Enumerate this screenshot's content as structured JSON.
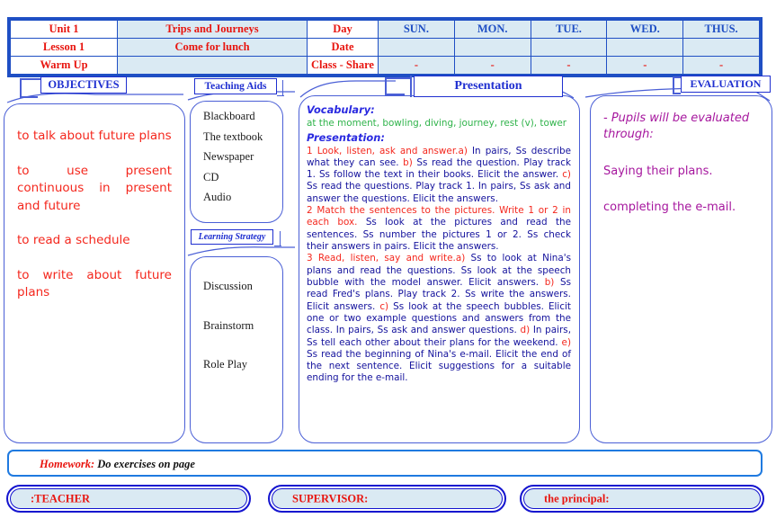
{
  "header_table": {
    "rows": [
      {
        "label": "Unit 1",
        "value": "Trips and Journeys",
        "key": "Day",
        "days": [
          "SUN.",
          "MON.",
          "TUE.",
          "WED.",
          "THUS."
        ]
      },
      {
        "label": "Lesson 1",
        "value": "Come for lunch",
        "key": "Date",
        "days": [
          "",
          "",
          "",
          "",
          ""
        ]
      },
      {
        "label": "Warm Up",
        "value": "",
        "key": "Class - Share",
        "days": [
          "-",
          "-",
          "-",
          "-",
          "-"
        ]
      }
    ]
  },
  "objectives": {
    "tag": "OBJECTIVES",
    "items": [
      "to talk about future plans",
      "to use present continuous in present and future",
      "to read a schedule",
      "to write about future plans"
    ]
  },
  "teaching_aids": {
    "tag": "Teaching Aids",
    "items": [
      "Blackboard",
      "The textbook",
      "Newspaper",
      "CD",
      "Audio"
    ]
  },
  "learning_strategy": {
    "tag": "Learning Strategy",
    "items": [
      "Discussion",
      "Brainstorm",
      "Role Play"
    ]
  },
  "presentation": {
    "tag": "Presentation",
    "vocabulary_heading": "Vocabulary:",
    "vocabulary": "at the moment, bowling, diving, journey, rest (v), tower",
    "presentation_heading": "Presentation:",
    "item1_title": "1 Look, listen, ask and answer.",
    "item1_a": "a)",
    "item1_a_text": " In pairs, Ss describe what they can see. ",
    "item1_b": "b)",
    "item1_b_text": " Ss read the question. Play track 1. Ss follow the text in their books. Elicit the answer. ",
    "item1_c": "c)",
    "item1_c_text": " Ss read the questions. Play track 1. In pairs, Ss ask and answer the questions. Elicit the answers.",
    "item2_title": "2 Match the sentences to the pictures. Write 1 or 2 in each box.",
    "item2_text": " Ss look at the pictures and read the sentences. Ss number the pictures 1 or 2. Ss check their answers in pairs. Elicit the answers.",
    "item3_title": "3 Read, listen, say and write.",
    "item3_a": "a)",
    "item3_a_text": " Ss to look at Nina's plans and read the questions. Ss look at the speech bubble with the model answer. Elicit answers. ",
    "item3_b": "b)",
    "item3_b_text": " Ss read Fred's plans. Play track 2. Ss write the answers. Elicit answers. ",
    "item3_c": "c)",
    "item3_c_text": " Ss look at the speech bubbles. Elicit one or two example questions and answers from the class. In pairs, Ss ask and answer questions. ",
    "item3_d": "d)",
    "item3_d_text": " In pairs, Ss tell each other about their plans for the weekend. ",
    "item3_e": "e)",
    "item3_e_text": " Ss read the beginning of Nina's e-mail. Elicit the end of the next sentence. Elicit suggestions for a suitable ending for the e-mail."
  },
  "evaluation": {
    "tag": "EVALUATION",
    "lead": "- Pupils will be evaluated through:",
    "items": [
      "Saying their plans.",
      "completing the e-mail."
    ]
  },
  "homework": {
    "label": "Homework:",
    "value": "Do exercises on page"
  },
  "signatures": {
    "teacher": ":TEACHER",
    "supervisor": "SUPERVISOR:",
    "principal": "the principal:"
  },
  "colors": {
    "frame_blue": "#1f4fc4",
    "label_red": "#e8150f",
    "cell_fill": "#daeaf3",
    "objective_red": "#f4271d",
    "vocab_green": "#2fb34a",
    "body_navy": "#13119c",
    "eval_purple": "#a6179e",
    "tag_blue": "#1f2fd0"
  }
}
